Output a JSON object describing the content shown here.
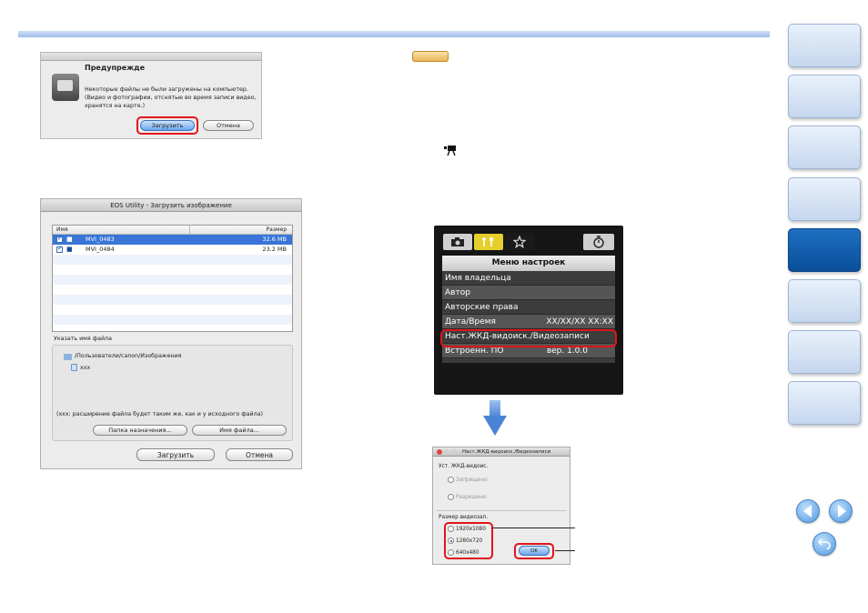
{
  "colors": {
    "accent_blue": "#0a4f9a",
    "highlight_red": "#e2141c",
    "selection": "#3875d7"
  },
  "nav": {
    "tabs_count": 8,
    "active_tab_index": 4,
    "prev_icon": "arrow-left-icon",
    "next_icon": "arrow-right-icon",
    "back_icon": "return-icon"
  },
  "warning_dialog": {
    "heading": "Предупрежде",
    "message": "Некоторые файлы не были загружены на компьютер. (Видео и фотографии, отснятые во время записи видео, хранятся на карте.)",
    "download_button": "Загрузить",
    "cancel_button": "Отмена"
  },
  "download_dialog": {
    "title": "EOS Utility - Загрузить изображение",
    "columns": {
      "name": "Имя",
      "size": "Размер"
    },
    "files": [
      {
        "name": "MVI_0483",
        "size": "32.6 MB",
        "selected": true
      },
      {
        "name": "MVI_0484",
        "size": "23.2 MB",
        "selected": false
      }
    ],
    "filename_group_label": "Указать имя файла",
    "path": "/Пользователи/canon/Изображения",
    "file_pattern": "xxx",
    "note": "(xxx: расширение файла будет таким же, как и у исходного файла)",
    "folder_button": "Папка назначения...",
    "filename_button": "Имя файла...",
    "download_button": "Загрузить",
    "cancel_button": "Отмена"
  },
  "camera_menu": {
    "header": "Меню настроек",
    "items": [
      {
        "label": "Имя владельца",
        "value": ""
      },
      {
        "label": "Автор",
        "value": ""
      },
      {
        "label": "Авторские права",
        "value": ""
      },
      {
        "label": "Дата/Время",
        "value": "XX/XX/XX XX:XX"
      },
      {
        "label": "Наст.ЖКД-видоиск./Видеозаписи",
        "value": ""
      },
      {
        "label": "Встроенн. ПО",
        "value": "вер. 1.0.0"
      }
    ]
  },
  "video_dialog": {
    "title": "Наст.ЖКД-видоиск./Видеозаписи",
    "lcd_label": "Уст. ЖКД-видоис.",
    "lcd_options": [
      "Запрещено",
      "Разрешено"
    ],
    "size_label": "Размер видеозап.",
    "size_options": [
      "1920x1080",
      "1280x720",
      "640x480"
    ],
    "size_selected_index": 1,
    "ok_button": "OK"
  }
}
